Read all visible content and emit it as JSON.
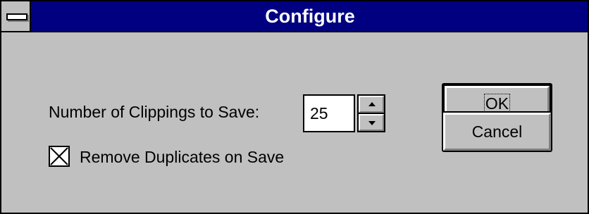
{
  "window": {
    "title": "Configure"
  },
  "form": {
    "clippings_label": "Number of Clippings to Save:",
    "clippings_value": "25",
    "remove_duplicates_label": "Remove Duplicates on Save",
    "remove_duplicates_checked": true
  },
  "buttons": {
    "ok_label": "OK",
    "cancel_label": "Cancel"
  },
  "icons": {
    "system_menu": "system-menu-icon",
    "spin_up": "arrow-up-icon",
    "spin_down": "arrow-down-icon",
    "checkbox_mark": "checkmark-x-icon"
  },
  "colors": {
    "titlebar": "#000080",
    "face": "#c0c0c0",
    "title_text": "#ffffff"
  }
}
